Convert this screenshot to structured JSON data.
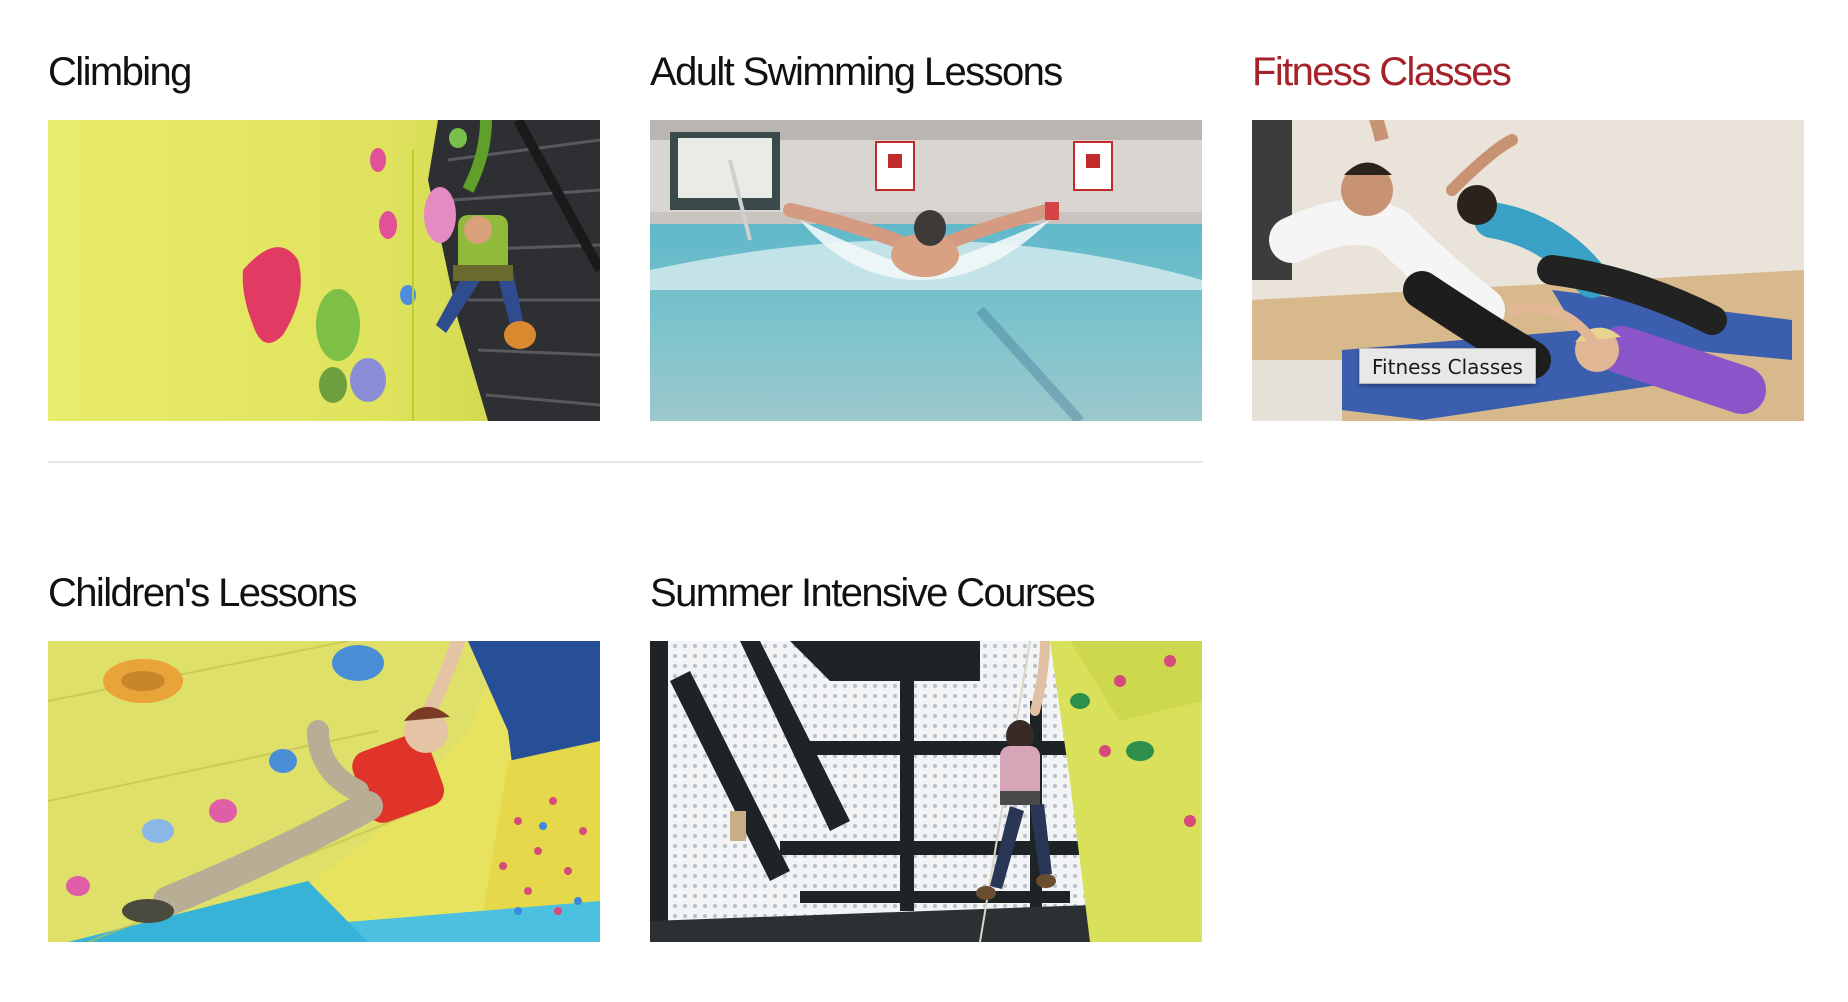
{
  "cards": [
    {
      "title": "Climbing",
      "image": "climbing-wall-photo"
    },
    {
      "title": "Adult Swimming Lessons",
      "image": "swimmer-butterfly-photo"
    },
    {
      "title": "Fitness Classes",
      "image": "fitness-class-photo"
    },
    {
      "title": "Children's Lessons",
      "image": "child-climbing-photo"
    },
    {
      "title": "Summer Intensive Courses",
      "image": "indoor-climber-photo"
    }
  ],
  "tooltip": {
    "text": "Fitness Classes"
  },
  "colors": {
    "title": "#111111",
    "title_hover": "#a4232a",
    "divider": "#e6e6e6"
  }
}
